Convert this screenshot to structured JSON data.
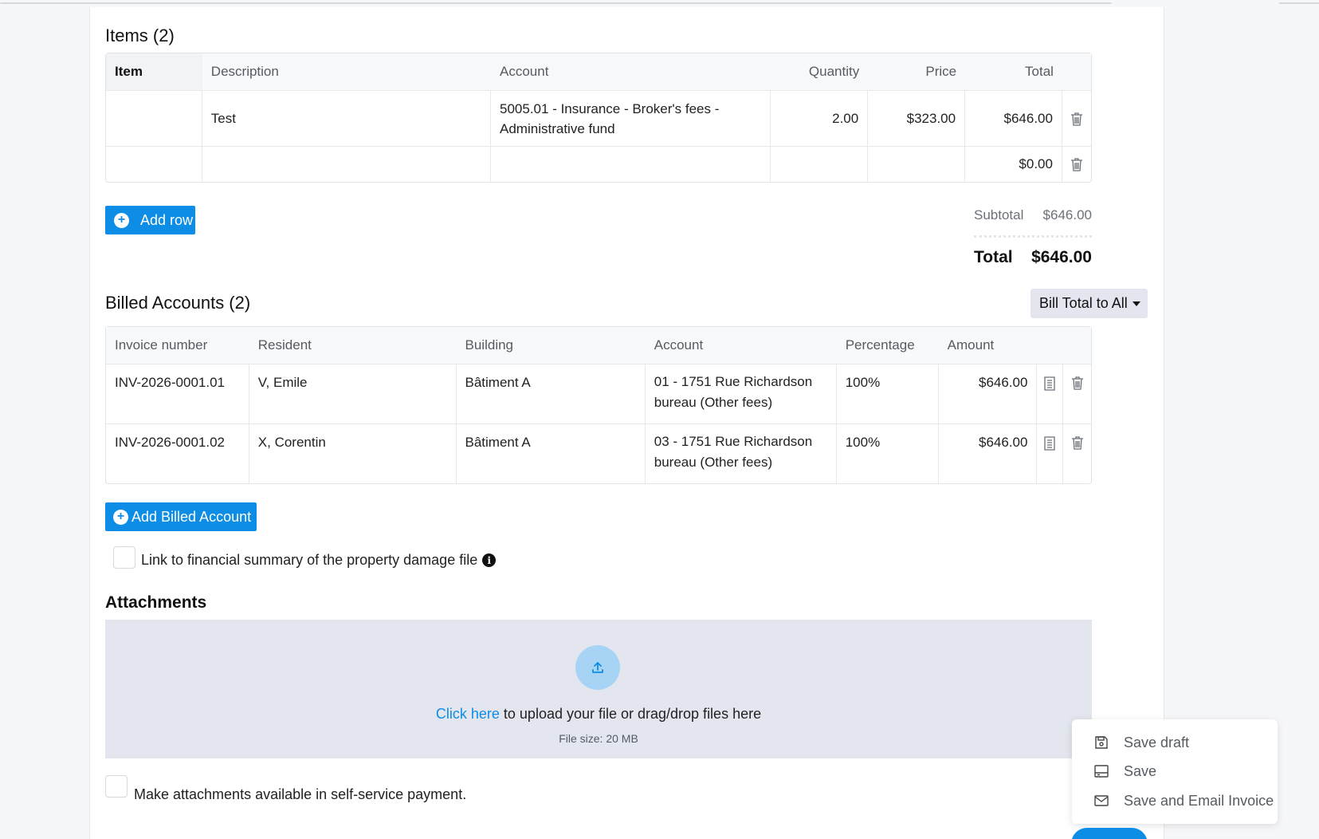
{
  "items": {
    "title": "Items (2)",
    "columns": [
      "Item",
      "Description",
      "Account",
      "Quantity",
      "Price",
      "Total"
    ],
    "rows": [
      {
        "item": "",
        "description": "Test",
        "account": [
          "5005.01 - Insurance - Broker's fees -",
          "Administrative fund"
        ],
        "quantity": "2.00",
        "price": "$323.00",
        "total": "$646.00"
      },
      {
        "item": "",
        "description": "",
        "account": [
          "",
          ""
        ],
        "quantity": "",
        "price": "",
        "total": "$0.00"
      }
    ],
    "add_row_label": "Add row",
    "subtotal_label": "Subtotal",
    "subtotal_value": "$646.00",
    "total_label": "Total",
    "total_value": "$646.00"
  },
  "billed": {
    "title": "Billed Accounts (2)",
    "bill_total_label": "Bill Total to All",
    "columns": [
      "Invoice number",
      "Resident",
      "Building",
      "Account",
      "Percentage",
      "Amount"
    ],
    "rows": [
      {
        "invoice": "INV-2026-0001.01",
        "resident": "V, Emile",
        "building": "Bâtiment A",
        "account": [
          "01 - 1751 Rue Richardson",
          "bureau (Other fees)"
        ],
        "percentage": "100%",
        "amount": "$646.00"
      },
      {
        "invoice": "INV-2026-0001.02",
        "resident": "X, Corentin",
        "building": "Bâtiment A",
        "account": [
          "03 - 1751 Rue Richardson",
          "bureau (Other fees)"
        ],
        "percentage": "100%",
        "amount": "$646.00"
      }
    ],
    "add_label": "Add Billed Account",
    "link_label": "Link to financial summary of the property damage file"
  },
  "attachments": {
    "title": "Attachments",
    "click_here": "Click here",
    "upload_text": " to upload your file or drag/drop files here",
    "file_size": "File size: 20 MB",
    "self_service_label": "Make attachments available in self-service payment."
  },
  "menu": {
    "items": [
      {
        "label": "Save draft",
        "icon": "floppy-icon"
      },
      {
        "label": "Save",
        "icon": "save-tray-icon"
      },
      {
        "label": "Save and Email Invoice",
        "icon": "envelope-icon"
      }
    ]
  },
  "colors": {
    "accent": "#0d8de5",
    "dropzone": "#e3e6ee",
    "upload_circle": "#a7d4f5"
  }
}
